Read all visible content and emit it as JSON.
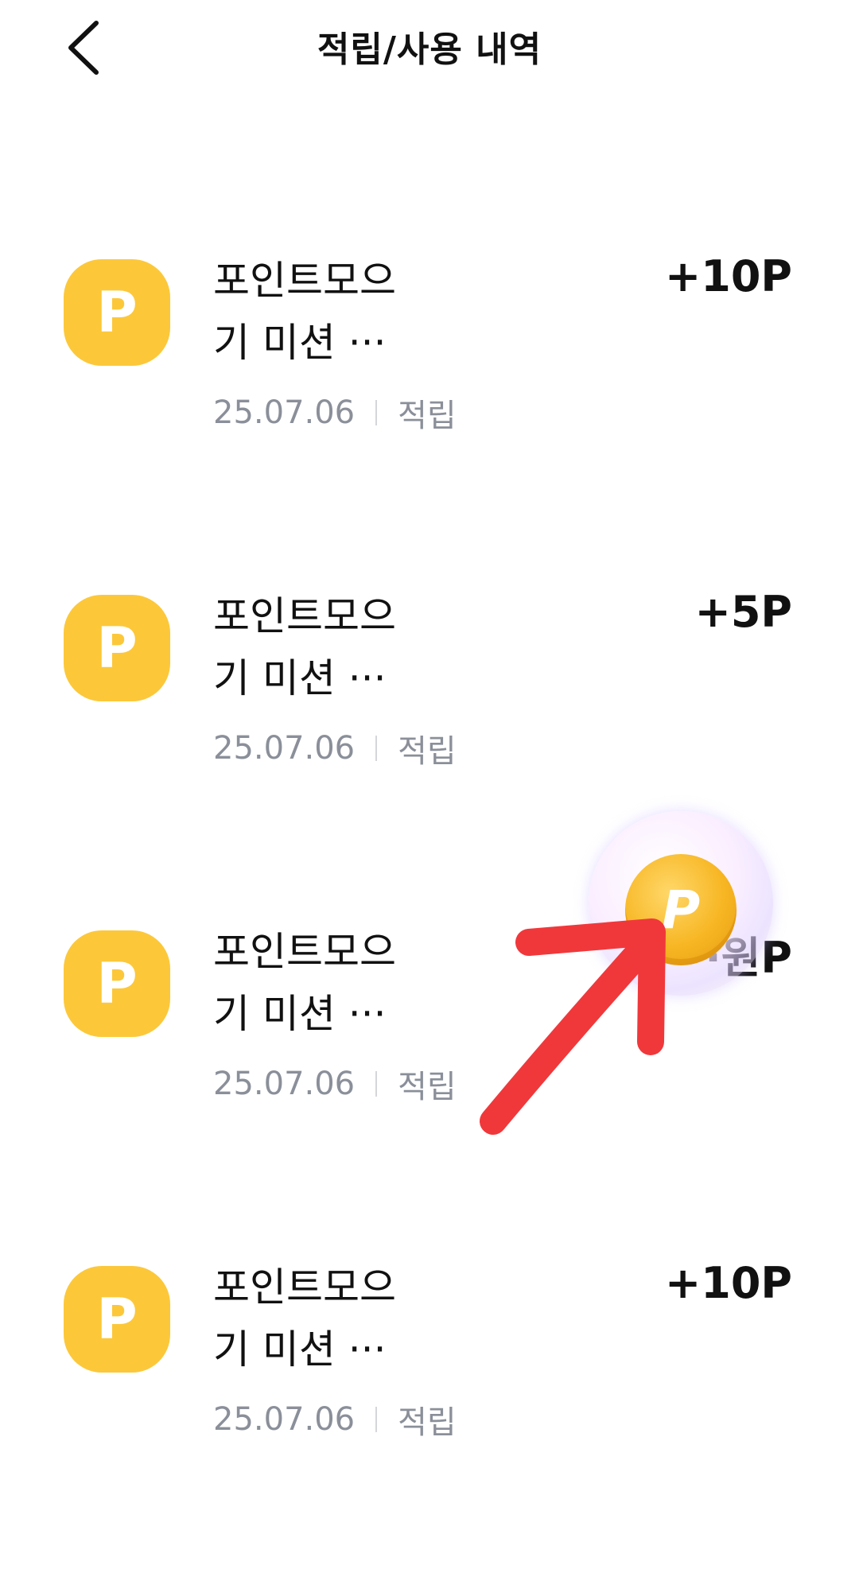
{
  "header": {
    "title": "적립/사용 내역",
    "back_icon": "chevron-left-icon"
  },
  "history": [
    {
      "icon_letter": "P",
      "title": "포인트모으기 미션 ···",
      "date": "25.07.06",
      "type": "적립",
      "amount": "+10P"
    },
    {
      "icon_letter": "P",
      "title": "포인트모으기 미션 ···",
      "date": "25.07.06",
      "type": "적립",
      "amount": "+5P"
    },
    {
      "icon_letter": "P",
      "title": "포인트모으기 미션 ···",
      "date": "25.07.06",
      "type": "적립",
      "amount": "··원P"
    },
    {
      "icon_letter": "P",
      "title": "포인트모으기 미션 ···",
      "date": "25.07.06",
      "type": "적립",
      "amount": "+10P"
    }
  ],
  "overlay": {
    "coin_letter": "P",
    "arrow_color": "#f0383b"
  },
  "colors": {
    "point_badge": "#fcc83a",
    "meta_text": "#8a8f99"
  }
}
